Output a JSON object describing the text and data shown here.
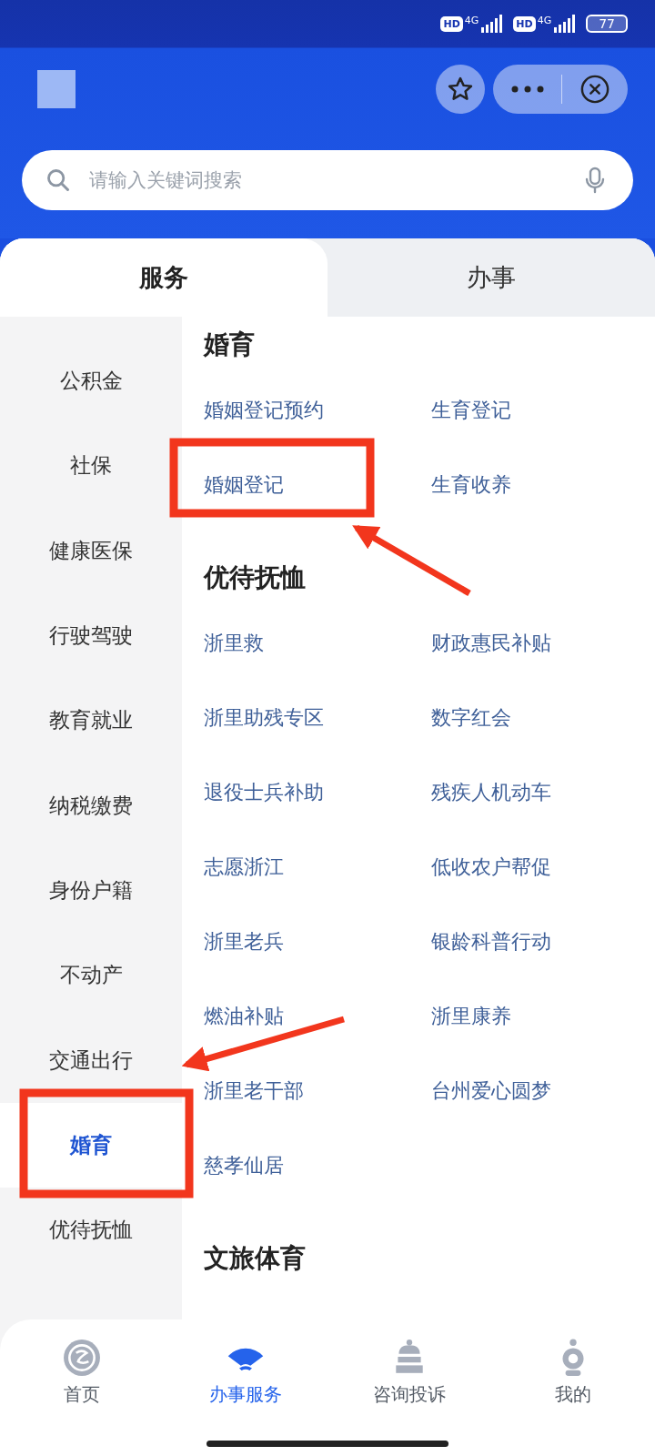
{
  "status_bar": {
    "sims": [
      {
        "badge": "HD",
        "network": "4G"
      },
      {
        "badge": "HD",
        "network": "4G"
      }
    ],
    "battery": "77"
  },
  "search": {
    "placeholder": "请输入关键词搜索"
  },
  "tabs": [
    {
      "label": "服务",
      "selected": true
    },
    {
      "label": "办事",
      "selected": false
    }
  ],
  "sidebar": {
    "items": [
      {
        "label": "公积金",
        "selected": false
      },
      {
        "label": "社保",
        "selected": false
      },
      {
        "label": "健康医保",
        "selected": false
      },
      {
        "label": "行驶驾驶",
        "selected": false
      },
      {
        "label": "教育就业",
        "selected": false
      },
      {
        "label": "纳税缴费",
        "selected": false
      },
      {
        "label": "身份户籍",
        "selected": false
      },
      {
        "label": "不动产",
        "selected": false
      },
      {
        "label": "交通出行",
        "selected": false
      },
      {
        "label": "婚育",
        "selected": true
      },
      {
        "label": "优待抚恤",
        "selected": false
      }
    ]
  },
  "sections": [
    {
      "title": "婚育",
      "links": [
        "婚姻登记预约",
        "生育登记",
        "婚姻登记",
        "生育收养"
      ]
    },
    {
      "title": "优待抚恤",
      "links": [
        "浙里救",
        "财政惠民补贴",
        "浙里助残专区",
        "数字红会",
        "退役士兵补助",
        "残疾人机动车",
        "志愿浙江",
        "低收农户帮促",
        "浙里老兵",
        "银龄科普行动",
        "燃油补贴",
        "浙里康养",
        "浙里老干部",
        "台州爱心圆梦",
        "慈孝仙居"
      ]
    },
    {
      "title": "文旅体育"
    }
  ],
  "bottom_nav": [
    {
      "label": "首页",
      "selected": false
    },
    {
      "label": "办事服务",
      "selected": true
    },
    {
      "label": "咨询投诉",
      "selected": false
    },
    {
      "label": "我的",
      "selected": false
    }
  ]
}
